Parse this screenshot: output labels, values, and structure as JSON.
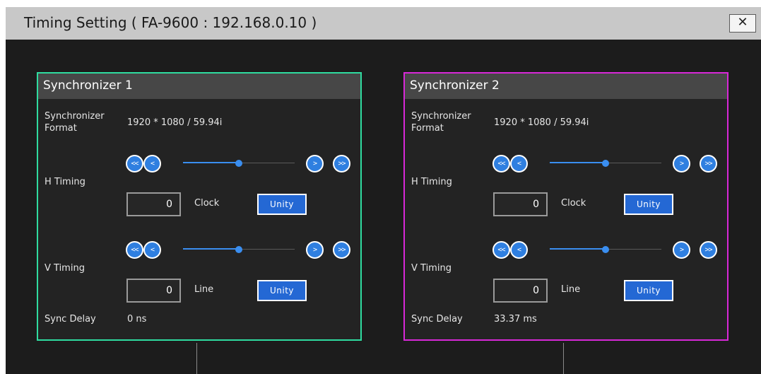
{
  "window": {
    "title": "Timing Setting ( FA-9600 : 192.168.0.10 )",
    "close_label": "✕"
  },
  "panels": [
    {
      "title": "Synchronizer 1",
      "border_color": "#2fdca0",
      "format_label": "Synchronizer Format",
      "format_value": "1920 * 1080 / 59.94i",
      "h_timing": {
        "label": "H Timing",
        "value": "0",
        "unit": "Clock",
        "unity_label": "Unity",
        "slider_level": 0.5,
        "btn_fast_back": "<<",
        "btn_back": "<",
        "btn_fwd": ">",
        "btn_fast_fwd": ">>"
      },
      "v_timing": {
        "label": "V Timing",
        "value": "0",
        "unit": "Line",
        "unity_label": "Unity",
        "slider_level": 0.5,
        "btn_fast_back": "<<",
        "btn_back": "<",
        "btn_fwd": ">",
        "btn_fast_fwd": ">>"
      },
      "sync_delay_label": "Sync Delay",
      "sync_delay_value": "0 ns"
    },
    {
      "title": "Synchronizer 2",
      "border_color": "#d828d8",
      "format_label": "Synchronizer Format",
      "format_value": "1920 * 1080 / 59.94i",
      "h_timing": {
        "label": "H Timing",
        "value": "0",
        "unit": "Clock",
        "unity_label": "Unity",
        "slider_level": 0.5,
        "btn_fast_back": "<<",
        "btn_back": "<",
        "btn_fwd": ">",
        "btn_fast_fwd": ">>"
      },
      "v_timing": {
        "label": "V Timing",
        "value": "0",
        "unit": "Line",
        "unity_label": "Unity",
        "slider_level": 0.5,
        "btn_fast_back": "<<",
        "btn_back": "<",
        "btn_fwd": ">",
        "btn_fast_fwd": ">>"
      },
      "sync_delay_label": "Sync Delay",
      "sync_delay_value": "33.37 ms"
    }
  ]
}
